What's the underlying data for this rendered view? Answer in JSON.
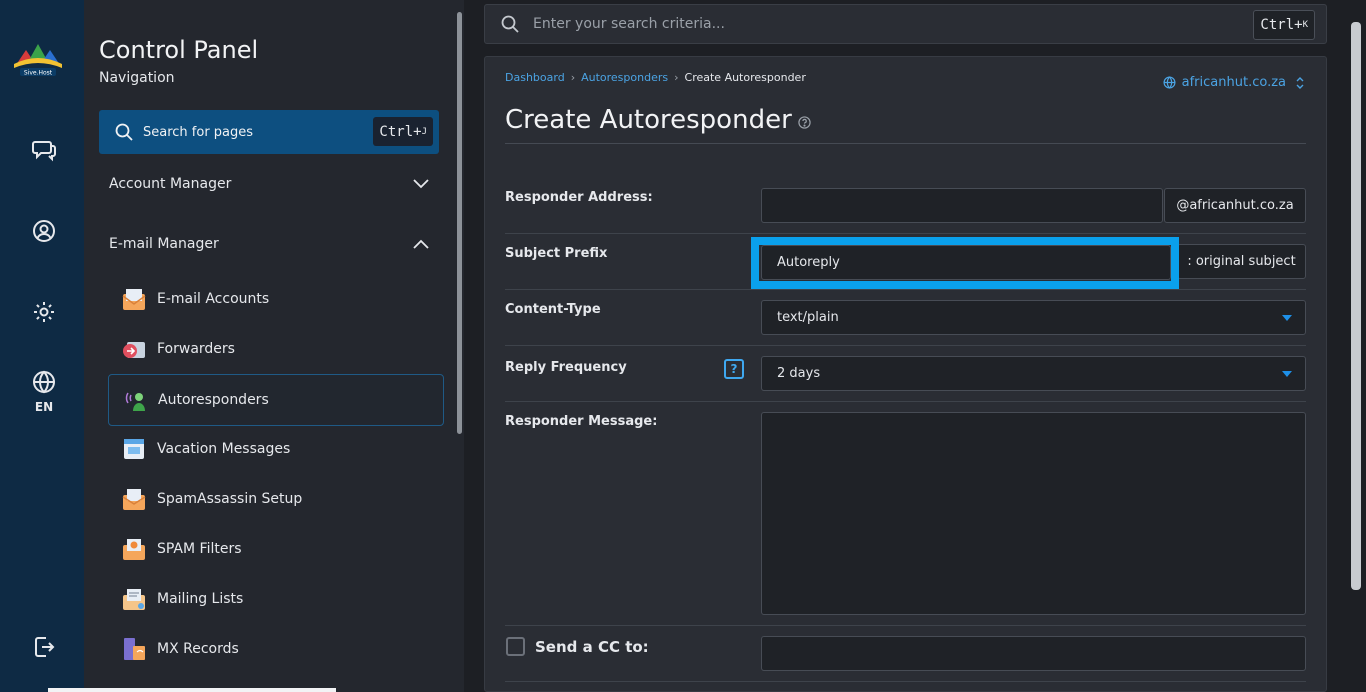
{
  "rail": {
    "logo_text": "Sive.Host",
    "lang": "EN"
  },
  "nav": {
    "title": "Control Panel",
    "subtitle": "Navigation",
    "search_label": "Search for pages",
    "search_shortcut": "Ctrl+",
    "search_shortcut_key": "J",
    "groups": [
      {
        "label": "Account Manager",
        "expanded": false
      },
      {
        "label": "E-mail Manager",
        "expanded": true
      }
    ],
    "items": [
      {
        "label": "E-mail Accounts",
        "icon": "email-accounts-icon"
      },
      {
        "label": "Forwarders",
        "icon": "forwarders-icon"
      },
      {
        "label": "Autoresponders",
        "icon": "autoresponders-icon",
        "active": true
      },
      {
        "label": "Vacation Messages",
        "icon": "vacation-messages-icon"
      },
      {
        "label": "SpamAssassin Setup",
        "icon": "spamassassin-icon"
      },
      {
        "label": "SPAM Filters",
        "icon": "spam-filters-icon"
      },
      {
        "label": "Mailing Lists",
        "icon": "mailing-lists-icon"
      },
      {
        "label": "MX Records",
        "icon": "mx-records-icon"
      }
    ]
  },
  "top_search": {
    "placeholder": "Enter your search criteria...",
    "shortcut": "Ctrl+",
    "shortcut_key": "K"
  },
  "main": {
    "breadcrumbs": [
      "Dashboard",
      "Autoresponders",
      "Create Autoresponder"
    ],
    "domain": "africanhut.co.za",
    "title": "Create Autoresponder",
    "form": {
      "responder_address_label": "Responder Address:",
      "responder_address_value": "",
      "responder_address_suffix": "@africanhut.co.za",
      "subject_prefix_label": "Subject Prefix",
      "subject_prefix_value": "Autoreply",
      "subject_prefix_suffix": ": original subject",
      "content_type_label": "Content-Type",
      "content_type_value": "text/plain",
      "reply_frequency_label": "Reply Frequency",
      "reply_frequency_help": "?",
      "reply_frequency_value": "2 days",
      "responder_message_label": "Responder Message:",
      "responder_message_value": "",
      "send_cc_label": "Send a CC to:",
      "send_cc_value": ""
    }
  },
  "colors": {
    "rail_bg": "#0e2a44",
    "accent": "#0aa0ec",
    "link": "#4ba3e3",
    "panel_bg": "#24272e",
    "card_bg": "#2a2d34"
  }
}
